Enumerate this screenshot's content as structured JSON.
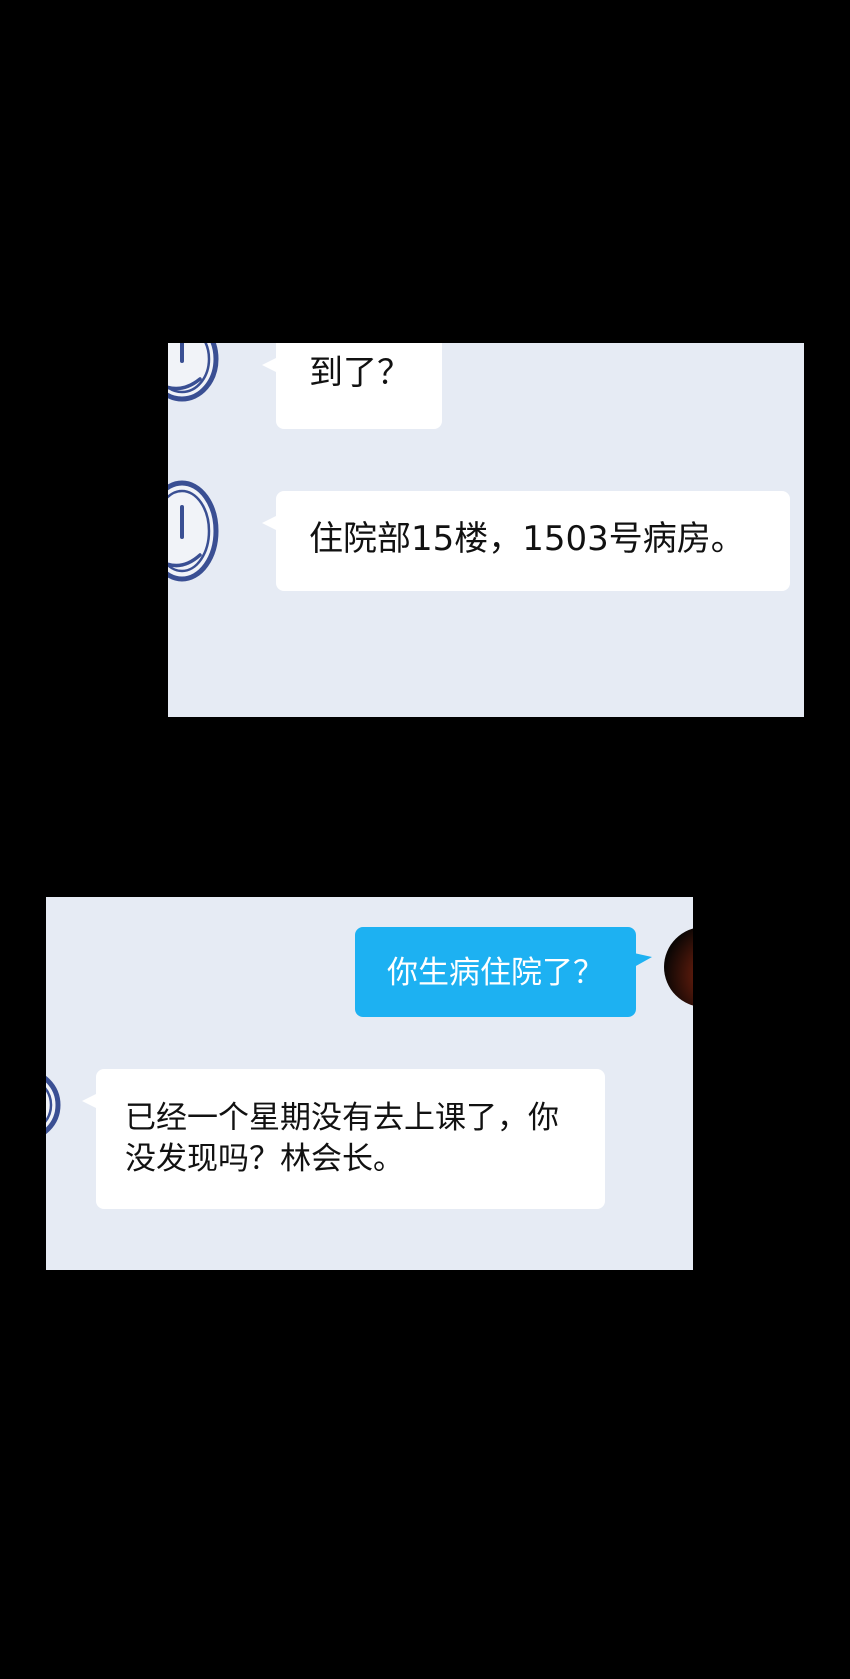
{
  "chat_top": {
    "messages": [
      {
        "sender": "contact",
        "text": "到了？"
      },
      {
        "sender": "contact",
        "text": "住院部15楼，1503号病房。"
      }
    ]
  },
  "chat_bottom": {
    "messages": [
      {
        "sender": "self",
        "text": "你生病住院了？"
      },
      {
        "sender": "contact",
        "text_line1": "已经一个星期没有去上课了，你",
        "text_line2": "没发现吗？林会长。"
      }
    ]
  },
  "icons": {
    "contact_avatar": "smiley-face-icon",
    "self_avatar": "dark-avatar-photo"
  },
  "colors": {
    "chat_background": "#e6ebf4",
    "incoming_bubble": "#ffffff",
    "outgoing_bubble": "#1db1f2",
    "avatar_stroke": "#3a4f93",
    "page_background": "#000000"
  }
}
